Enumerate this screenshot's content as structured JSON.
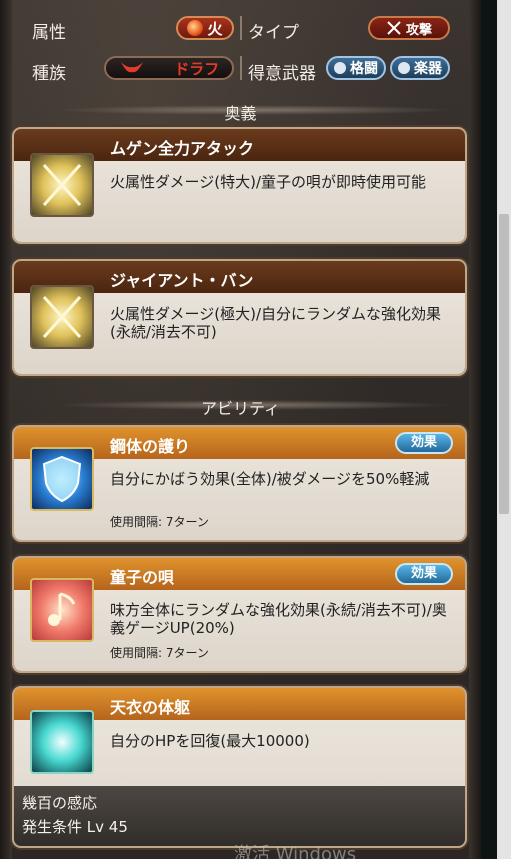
{
  "info": {
    "attribute_label": "属性",
    "element": "火",
    "type_label": "タイプ",
    "type_value": "攻撃",
    "race_label": "種族",
    "race_value": "ドラフ",
    "weapon_label": "得意武器",
    "weapons": [
      "格闘",
      "楽器"
    ]
  },
  "sections": {
    "ougi": "奥義",
    "ability": "アビリティ"
  },
  "ougi": [
    {
      "name": "ムゲン全力アタック",
      "desc": "火属性ダメージ(特大)/童子の唄が即時使用可能"
    },
    {
      "name": "ジャイアント・バン",
      "desc": "火属性ダメージ(極大)/自分にランダムな強化効果(永続/消去不可)"
    }
  ],
  "abilities": [
    {
      "name": "鋼体の護り",
      "desc": "自分にかばう効果(全体)/被ダメージを50%軽減",
      "cooldown": "使用間隔: 7ターン",
      "badge": "効果"
    },
    {
      "name": "童子の唄",
      "desc": "味方全体にランダムな強化効果(永続/消去不可)/奥義ゲージUP(20%)",
      "cooldown": "使用間隔: 7ターン",
      "badge": "効果"
    }
  ],
  "support": {
    "name": "天衣の体躯",
    "desc": "自分のHPを回復(最大10000)",
    "extra_name": "幾百の感応",
    "extra_condition": "発生条件 Lv 45"
  },
  "watermark": "激活 Windows",
  "icons": {
    "ougi": "crossed-swords-icon",
    "ability1": "shield-icon",
    "ability2": "music-note-icon",
    "support": "heal-burst-icon",
    "element": "fire-icon",
    "type": "crossed-swords-small-icon",
    "race": "draph-horns-icon",
    "weapon1": "fist-icon",
    "weapon2": "instrument-icon"
  },
  "colors": {
    "fire": "#a8321c",
    "ability_header": "#e0932d",
    "ougi_header": "#6a3b1c",
    "effect_badge": "#58b4e4"
  }
}
